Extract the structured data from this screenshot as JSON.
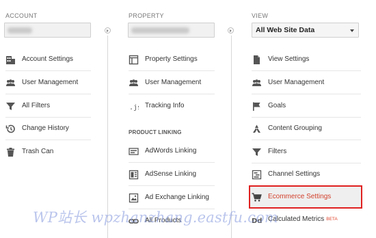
{
  "columns": {
    "account": {
      "label": "ACCOUNT",
      "items": [
        {
          "label": "Account Settings",
          "icon": "building-icon"
        },
        {
          "label": "User Management",
          "icon": "users-icon"
        },
        {
          "label": "All Filters",
          "icon": "filter-icon"
        },
        {
          "label": "Change History",
          "icon": "history-icon"
        },
        {
          "label": "Trash Can",
          "icon": "trash-icon"
        }
      ]
    },
    "property": {
      "label": "PROPERTY",
      "items": [
        {
          "label": "Property Settings",
          "icon": "window-icon"
        },
        {
          "label": "User Management",
          "icon": "users-icon"
        },
        {
          "label": "Tracking Info",
          "icon": "js-icon"
        }
      ],
      "section": "PRODUCT LINKING",
      "linking": [
        {
          "label": "AdWords Linking",
          "icon": "adwords-icon"
        },
        {
          "label": "AdSense Linking",
          "icon": "adsense-icon"
        },
        {
          "label": "Ad Exchange Linking",
          "icon": "adexchange-icon"
        },
        {
          "label": "All Products",
          "icon": "link-icon"
        }
      ]
    },
    "view": {
      "label": "VIEW",
      "selected": "All Web Site Data",
      "items": [
        {
          "label": "View Settings",
          "icon": "document-icon"
        },
        {
          "label": "User Management",
          "icon": "users-icon"
        },
        {
          "label": "Goals",
          "icon": "flag-icon"
        },
        {
          "label": "Content Grouping",
          "icon": "grouping-icon"
        },
        {
          "label": "Filters",
          "icon": "filter-icon"
        },
        {
          "label": "Channel Settings",
          "icon": "channel-icon"
        },
        {
          "label": "Ecommerce Settings",
          "icon": "cart-icon"
        },
        {
          "label": "Calculated Metrics",
          "icon": "dd-icon",
          "badge": "BETA"
        }
      ]
    }
  },
  "colors": {
    "highlight_border": "#e02020",
    "ecommerce_text": "#d23f2a",
    "beta": "#e0442b"
  },
  "watermark": "WP站长 wpzhanzhang.eastfu.com"
}
